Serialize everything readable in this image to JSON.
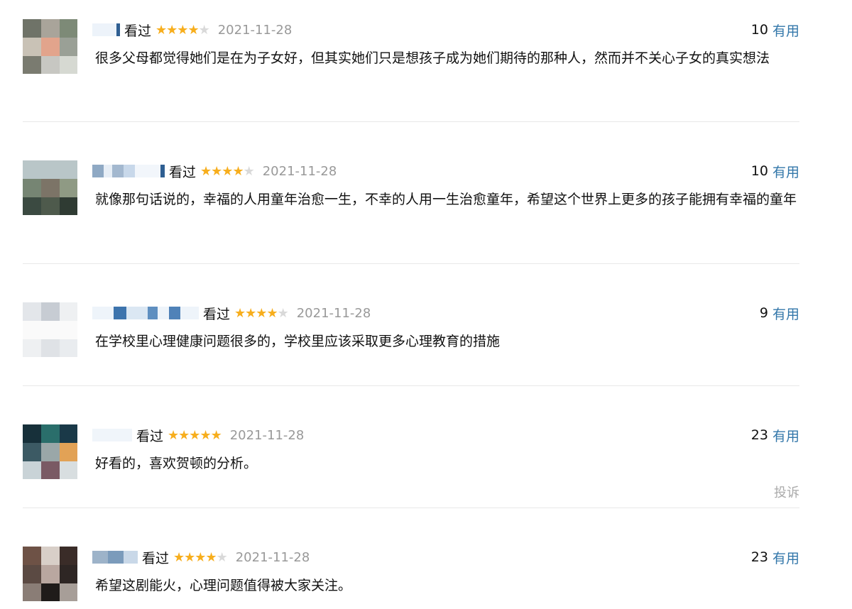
{
  "colors": {
    "star_filled": "#f7ae1d",
    "star_empty": "#d9d9d9",
    "date": "#999999",
    "useful_link": "#3377aa",
    "report_link": "#aaaaaa",
    "divider": "#e8e8e8"
  },
  "reviews": [
    {
      "status": "看过",
      "rating": 4,
      "date": "2021-11-28",
      "votes": "10",
      "useful_label": "有用",
      "content": "很多父母都觉得她们是在为子女好，但其实她们只是想孩子成为她们期待的那种人，然而并不关心子女的真实想法"
    },
    {
      "status": "看过",
      "rating": 4,
      "date": "2021-11-28",
      "votes": "10",
      "useful_label": "有用",
      "content": "就像那句话说的，幸福的人用童年治愈一生，不幸的人用一生治愈童年，希望这个世界上更多的孩子能拥有幸福的童年"
    },
    {
      "status": "看过",
      "rating": 4,
      "date": "2021-11-28",
      "votes": "9",
      "useful_label": "有用",
      "content": "在学校里心理健康问题很多的，学校里应该采取更多心理教育的措施"
    },
    {
      "status": "看过",
      "rating": 5,
      "date": "2021-11-28",
      "votes": "23",
      "useful_label": "有用",
      "content": "好看的，喜欢贺顿的分析。",
      "report_label": "投诉"
    },
    {
      "status": "看过",
      "rating": 4,
      "date": "2021-11-28",
      "votes": "23",
      "useful_label": "有用",
      "content": "希望这剧能火，心理问题值得被大家关注。"
    }
  ]
}
